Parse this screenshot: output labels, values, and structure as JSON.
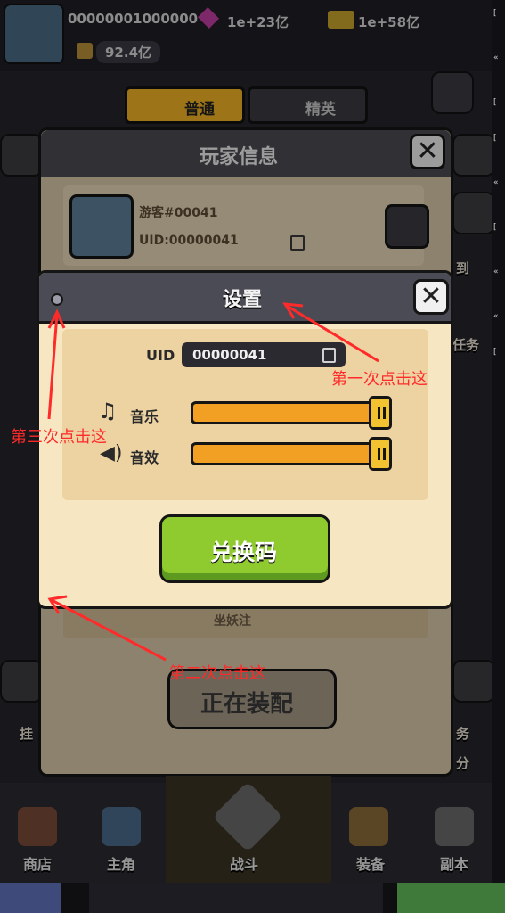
{
  "hud": {
    "currency1": "00000001000000",
    "gems": "1e+23亿",
    "tickets": "1e+58亿",
    "power": "92.4亿"
  },
  "tabs": {
    "normal": "普通",
    "elite": "精英"
  },
  "player_panel": {
    "title": "玩家信息",
    "name": "游客#00041",
    "uid": "UID:00000041",
    "sign": "坐妖注",
    "equip_button": "正在装配"
  },
  "side_left": [
    "挂"
  ],
  "side_right": [
    "到",
    "任务",
    "务",
    "分"
  ],
  "settings": {
    "title": "设置",
    "uid_label": "UID",
    "uid_value": "00000041",
    "music_label": "音乐",
    "music_level": 1.0,
    "sfx_label": "音效",
    "sfx_level": 1.0,
    "redeem_button": "兑换码"
  },
  "annotations": {
    "first": "第一次点击这",
    "second": "第二次点击这",
    "third": "第三次点击这",
    "color": "#ff2a2a"
  },
  "bottom_nav": [
    "商店",
    "主角",
    "战斗",
    "装备",
    "副本"
  ]
}
